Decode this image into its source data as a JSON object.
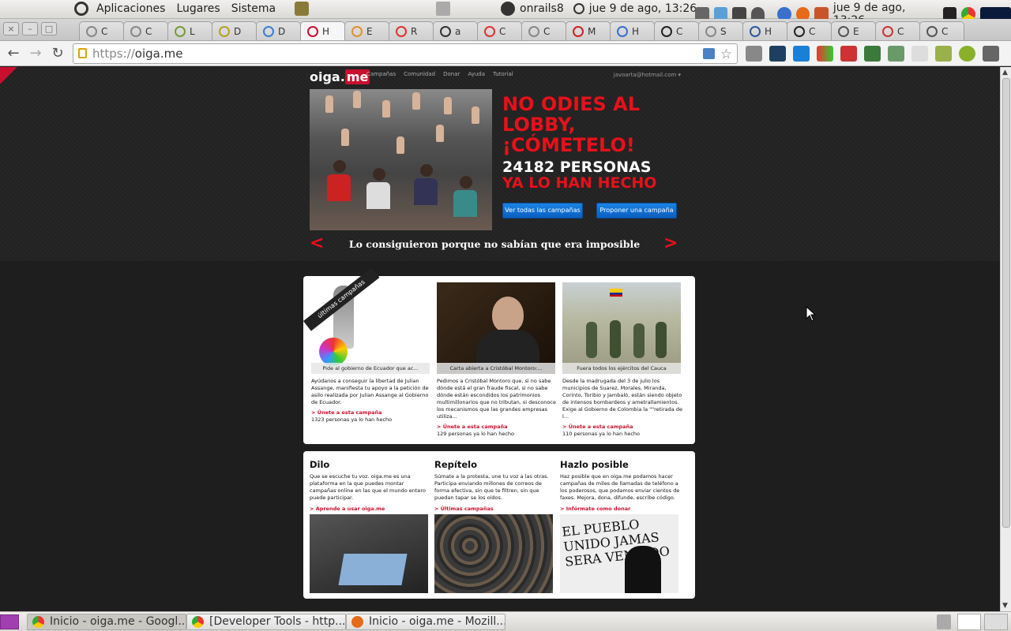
{
  "system_panel": {
    "menus": [
      "Aplicaciones",
      "Lugares",
      "Sistema"
    ],
    "user": "onrails8",
    "clock_1": "jue  9 de ago, 13:26",
    "clock_2": "jue  9 de ago, 13:26"
  },
  "browser": {
    "tab_titles": [
      "C",
      "C",
      "L",
      "D",
      "D",
      "H",
      "E",
      "R",
      "a",
      "C",
      "C",
      "M",
      "H",
      "C",
      "S",
      "H",
      "C",
      "E",
      "C",
      "C"
    ],
    "url_scheme": "https://",
    "url_host": "oiga.me",
    "window_buttons": [
      "×",
      "–",
      "□"
    ]
  },
  "site": {
    "logo_text": "oiga.",
    "logo_accent": "me",
    "nav": [
      "Campañas",
      "Comunidad",
      "Donar",
      "Ayuda",
      "Tutorial"
    ],
    "account": "javoarta@hotmail.com ▾",
    "hero": {
      "title": "NO ODIES AL\nLOBBY,\n¡CÓMETELO!",
      "count_line": "24182 PERSONAS",
      "count_sub": "YA LO HAN HECHO",
      "btn_all": "Ver todas las campañas",
      "btn_propose": "Proponer una campaña",
      "slider_text": "Lo consiguieron porque no sabían que era imposible",
      "prev": "<",
      "next": ">"
    },
    "campaigns": {
      "ribbon": "últimas campañas",
      "cards": [
        {
          "caption": "Pide al gobierno de Ecuador que ac...",
          "desc": "Ayúdanos a conseguir la libertad de Julian Assange, manifiesta tu apoyo a la petición de asilo realizada por Julian Assange al Gobierno de Ecuador.",
          "join": "> Únete a esta campaña",
          "count": "1323 personas ya lo han hecho"
        },
        {
          "caption": "Carta abierta a Cristóbal Montoro:...",
          "desc": "Pedimos a Cristóbal Montoro que, si no sabe dónde está el gran fraude fiscal, si no sabe dónde están escondidos los patrimonios multimillonarios que no tributan, si desconoce los mecanismos que las grandes empresas utiliza...",
          "join": "> Únete a esta campaña",
          "count": "129 personas ya lo han hecho"
        },
        {
          "caption": "Fuera todos los ejércitos del Cauca",
          "desc": "Desde la madrugada del 3 de julio los municipios de Suarez, Morales, Miranda, Corinto, Toribio y Jambaló, están siendo objeto de intensos bombardeos y ametrallamientos. Exige al Gobierno de Colombia la \"\"retirada de l...",
          "join": "> Únete a esta campaña",
          "count": "110 personas ya lo han hecho"
        }
      ]
    },
    "info": [
      {
        "title": "Dilo",
        "text": "Que se escuche tu voz. oiga.me es una plataforma en la que puedes montar campañas online en las que el mundo entero puede participar.",
        "link": "> Aprende a usar oiga.me"
      },
      {
        "title": "Repítelo",
        "text": "Súmate a la protesta, une tu voz a las otras. Participa enviando millones de correos de forma efectiva, sin que te filtren, sin que puedan tapar se los oídos.",
        "link": "> Últimas campañas"
      },
      {
        "title": "Hazlo posible",
        "text": "Haz posible que en oiga.me podamos hacer campañas de miles de llamadas de teléfono a los poderosos, que podamos enviar cientos de faxes. Mejora, dona, difunde, escribe código.",
        "link": "> Infórmate como donar"
      }
    ],
    "protest_sign": "EL PUEBLO\nUNIDO JAMAS\nSERA VENCIDO"
  },
  "taskbar": {
    "tasks": [
      "Inicio - oiga.me - Googl...",
      "[Developer Tools - http...",
      "Inicio - oiga.me - Mozill..."
    ]
  },
  "colors": {
    "accent_red": "#e8101a",
    "brand_red": "#c8102e",
    "button_blue": "#0a6ed1",
    "page_bg": "#1e1e1e"
  }
}
